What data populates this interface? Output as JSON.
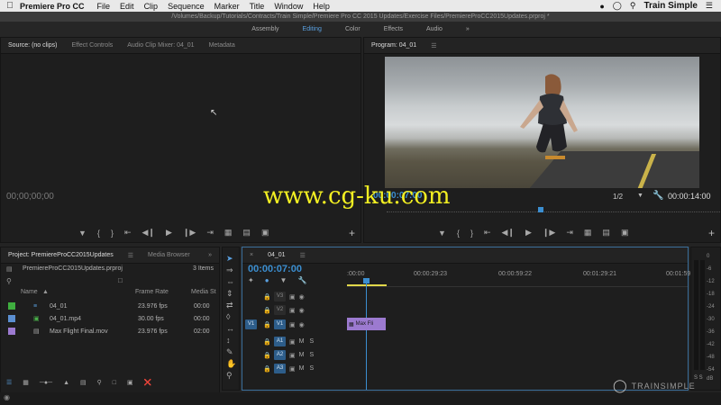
{
  "menubar": {
    "apple": "",
    "app_name": "Premiere Pro CC",
    "items": [
      "File",
      "Edit",
      "Clip",
      "Sequence",
      "Marker",
      "Title",
      "Window",
      "Help"
    ],
    "user": "Train Simple"
  },
  "titlebar": {
    "path": "/Volumes/Backup/Tutorials/Contracts/Train Simple/Premiere Pro CC 2015 Updates/Exercise Files/PremiereProCC2015Updates.prproj *"
  },
  "workspaces": {
    "items": [
      "Assembly",
      "Editing",
      "Color",
      "Effects",
      "Audio"
    ],
    "active": "Editing",
    "more": "»"
  },
  "source_panel": {
    "tabs": [
      "Source: (no clips)",
      "Effect Controls",
      "Audio Clip Mixer: 04_01",
      "Metadata"
    ],
    "timecode": "00;00;00;00"
  },
  "program_panel": {
    "tab": "Program: 04_01",
    "timecode_left": "00:00:07:00",
    "zoom": "1/2",
    "timecode_right": "00:00:14:00"
  },
  "watermark": "www.cg-ku.com",
  "project_panel": {
    "tabs": [
      "Project: PremiereProCC2015Updates",
      "Media Browser"
    ],
    "file": "PremiereProCC2015Updates.prproj",
    "item_count": "3 Items",
    "columns": [
      "Name",
      "Frame Rate",
      "Media St"
    ],
    "rows": [
      {
        "name": "04_01",
        "rate": "23.976 fps",
        "start": "00:00",
        "color": "#3fae3f"
      },
      {
        "name": "04_01.mp4",
        "rate": "30.00 fps",
        "start": "00:00",
        "color": "#5b8fd1"
      },
      {
        "name": "Max Flight Final.mov",
        "rate": "23.976 fps",
        "start": "02:00",
        "color": "#9c7ad0"
      }
    ]
  },
  "timeline": {
    "tab": "04_01",
    "timecode": "00:00:07:00",
    "ruler": [
      ":00:00",
      "00:00:29:23",
      "00:00:59:22",
      "00:01:29:21",
      "00:01:59:2"
    ],
    "video_tracks": [
      "V3",
      "V2",
      "V1"
    ],
    "audio_tracks": [
      "A1",
      "A2",
      "A3"
    ],
    "source_patch_v": "V1",
    "clip_label": "Max Fli"
  },
  "meter": {
    "scale": [
      "0",
      "-6",
      "-12",
      "-18",
      "-24",
      "-30",
      "-36",
      "-42",
      "-48",
      "-54",
      "dB"
    ],
    "solo": "S S"
  },
  "branding": "TRAINSIMPLE",
  "colors": {
    "accent": "#3b8ed0",
    "clip": "#9c7ad0",
    "playhead": "#3b8ed0"
  }
}
